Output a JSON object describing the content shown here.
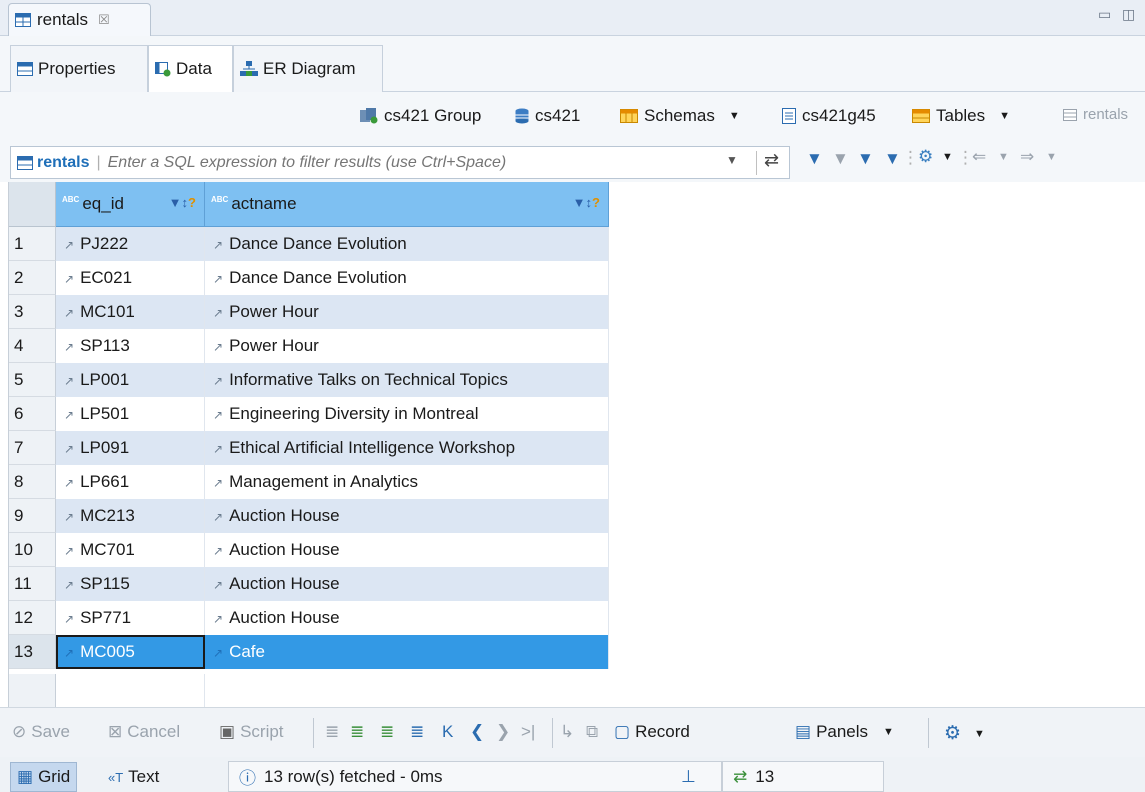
{
  "editor_tab": {
    "title": "rentals",
    "close": "☒"
  },
  "sub_tabs": [
    {
      "label": "Properties"
    },
    {
      "label": "Data"
    },
    {
      "label": "ER Diagram"
    }
  ],
  "breadcrumb": {
    "group": "cs421 Group",
    "connection": "cs421",
    "schemas": "Schemas",
    "database": "cs421g45",
    "tables": "Tables",
    "current": "rentals"
  },
  "filter": {
    "entity": "rentals",
    "placeholder": "Enter a SQL expression to filter results (use Ctrl+Space)"
  },
  "grid": {
    "columns": [
      {
        "name": "eq_id",
        "type_badge": "ABC"
      },
      {
        "name": "actname",
        "type_badge": "ABC"
      }
    ],
    "rows": [
      {
        "num": "1",
        "eq_id": "PJ222",
        "actname": "Dance Dance Evolution"
      },
      {
        "num": "2",
        "eq_id": "EC021",
        "actname": "Dance Dance Evolution"
      },
      {
        "num": "3",
        "eq_id": "MC101",
        "actname": "Power Hour"
      },
      {
        "num": "4",
        "eq_id": "SP113",
        "actname": "Power Hour"
      },
      {
        "num": "5",
        "eq_id": "LP001",
        "actname": "Informative Talks on Technical Topics"
      },
      {
        "num": "6",
        "eq_id": "LP501",
        "actname": "Engineering Diversity in Montreal"
      },
      {
        "num": "7",
        "eq_id": "LP091",
        "actname": "Ethical Artificial Intelligence Workshop"
      },
      {
        "num": "8",
        "eq_id": "LP661",
        "actname": "Management in Analytics"
      },
      {
        "num": "9",
        "eq_id": "MC213",
        "actname": "Auction House"
      },
      {
        "num": "10",
        "eq_id": "MC701",
        "actname": "Auction House"
      },
      {
        "num": "11",
        "eq_id": "SP115",
        "actname": "Auction House"
      },
      {
        "num": "12",
        "eq_id": "SP771",
        "actname": "Auction House"
      },
      {
        "num": "13",
        "eq_id": "MC005",
        "actname": "Cafe"
      }
    ],
    "selected_row": "13"
  },
  "toolbar": {
    "save": "Save",
    "cancel": "Cancel",
    "script": "Script",
    "record": "Record",
    "panels": "Panels"
  },
  "status": {
    "grid_tab": "Grid",
    "text_tab": "Text",
    "message": "13 row(s) fetched - 0ms",
    "row_count": "13"
  },
  "colors": {
    "header_blue": "#7ec0f2",
    "alt_row": "#dce6f3",
    "selected": "#3399e5",
    "accent": "#1f6fb8"
  }
}
